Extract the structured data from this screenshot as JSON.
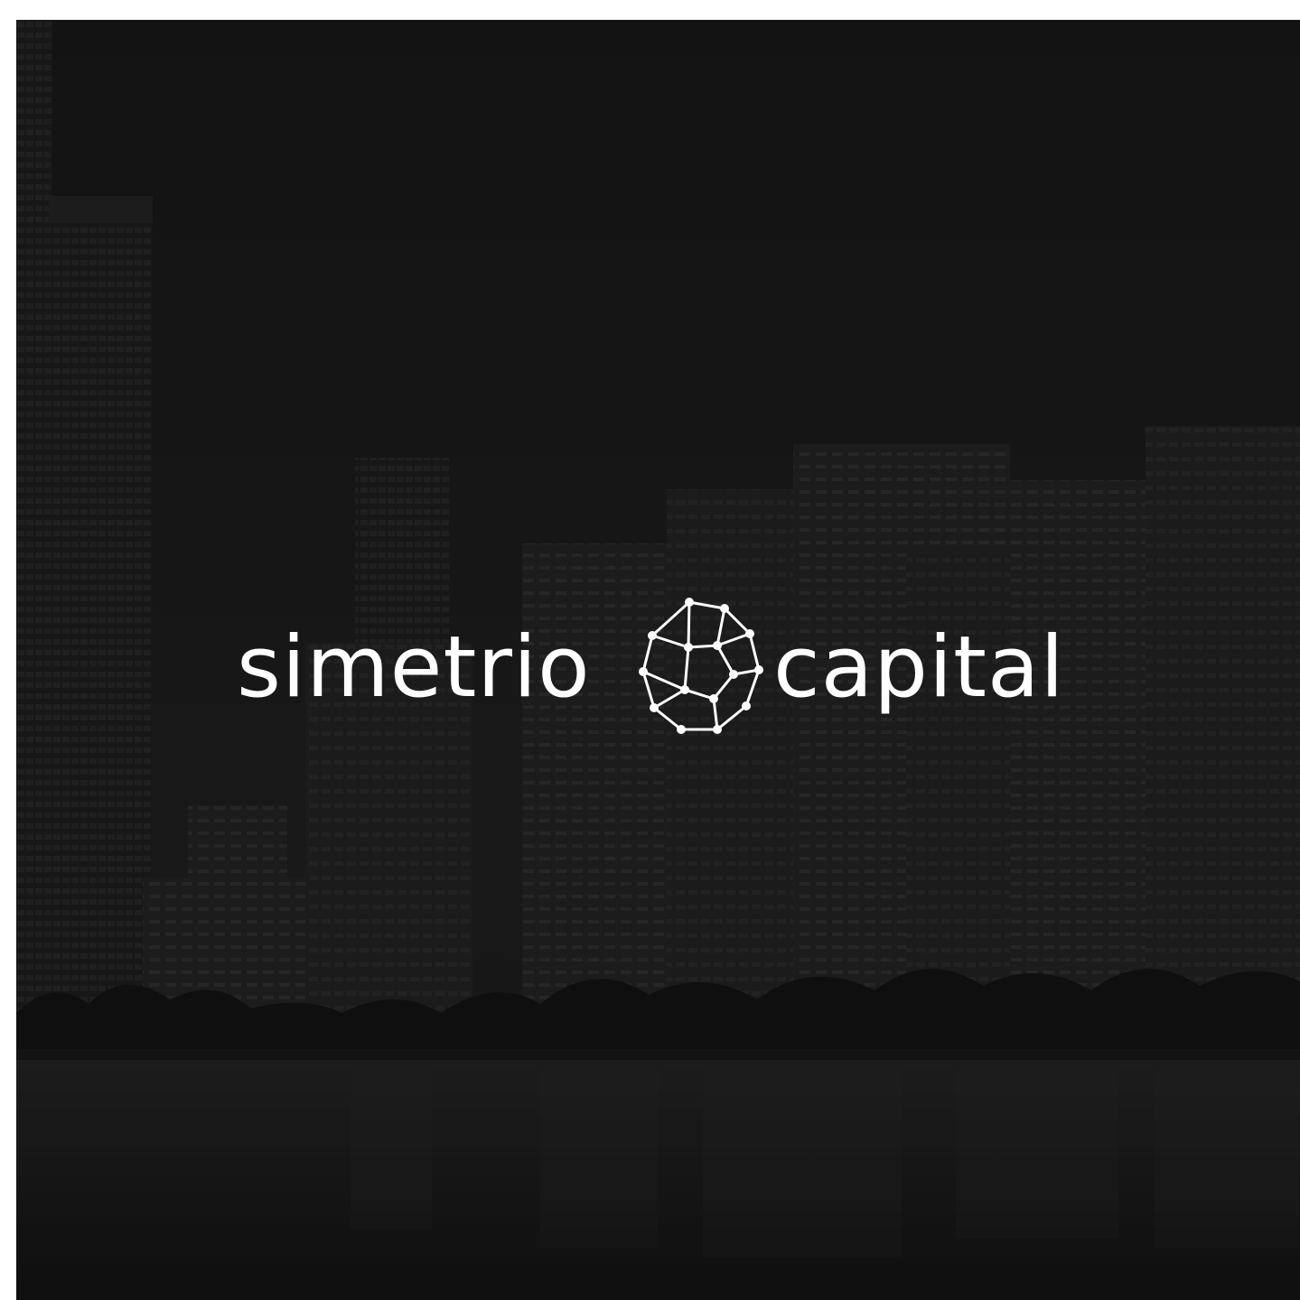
{
  "image": {
    "description_free": true
  },
  "logo": {
    "word_left": "simetrio",
    "word_right": "capital",
    "mark_icon": "dodecahedron-network-icon"
  },
  "colors": {
    "background": "#1c1c1c",
    "logo": "#ffffff"
  }
}
